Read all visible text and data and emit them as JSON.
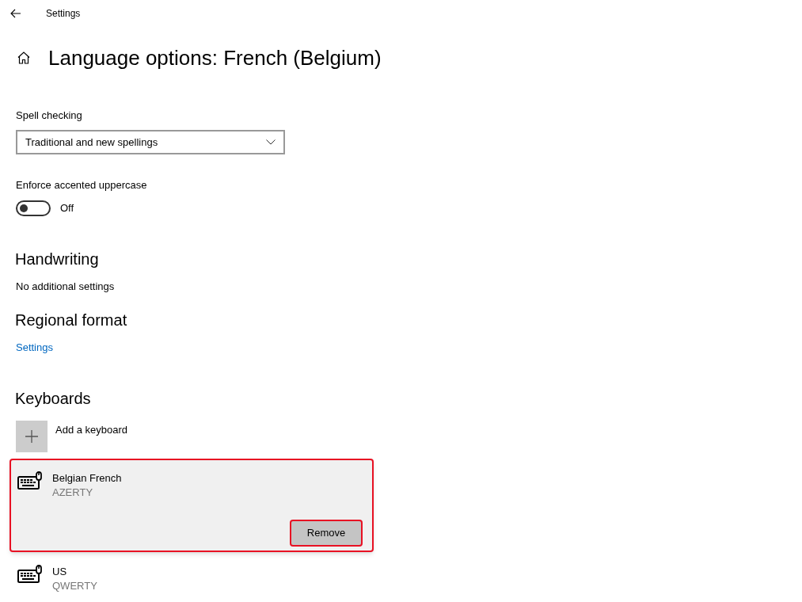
{
  "window": {
    "title": "Settings"
  },
  "page_title": "Language options: French (Belgium)",
  "spell_checking": {
    "label": "Spell checking",
    "value": "Traditional and new spellings"
  },
  "accented_uppercase": {
    "label": "Enforce accented uppercase",
    "on": false,
    "state_text": "Off"
  },
  "handwriting": {
    "heading": "Handwriting",
    "text": "No additional settings"
  },
  "regional_format": {
    "heading": "Regional format",
    "link": "Settings"
  },
  "keyboards": {
    "heading": "Keyboards",
    "add_label": "Add a keyboard",
    "items": [
      {
        "name": "Belgian French",
        "layout": "AZERTY",
        "selected": true,
        "button": "Remove"
      },
      {
        "name": "US",
        "layout": "QWERTY",
        "selected": false
      }
    ]
  }
}
